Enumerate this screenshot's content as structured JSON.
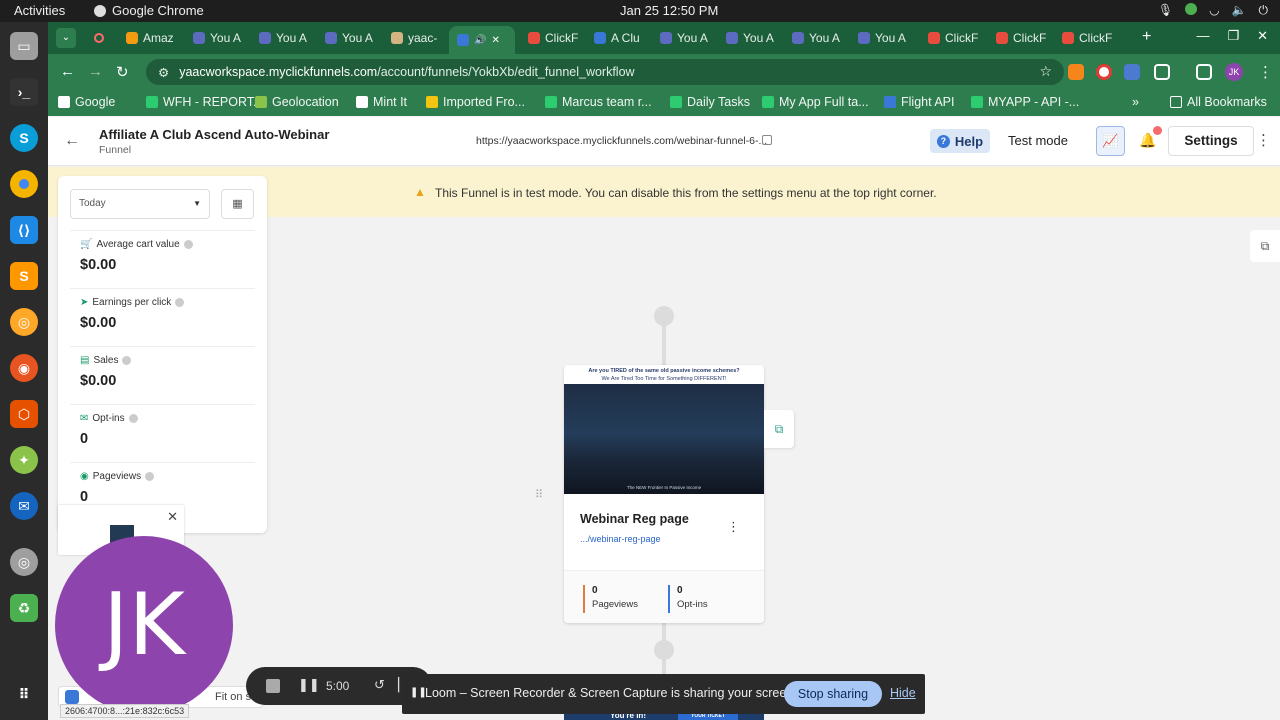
{
  "system": {
    "activities": "Activities",
    "app_name": "Google Chrome",
    "clock": "Jan 25  12:50 PM"
  },
  "browser": {
    "tabs": [
      {
        "label": "Amaz",
        "color": "#f39c12"
      },
      {
        "label": "You A",
        "color": "#5c6bc0"
      },
      {
        "label": "You A",
        "color": "#5c6bc0"
      },
      {
        "label": "You A",
        "color": "#5c6bc0"
      },
      {
        "label": "yaac-",
        "color": "#d4b483"
      },
      {
        "label": "",
        "color": "#3a78d8"
      },
      {
        "label": "ClickF",
        "color": "#e74c3c"
      },
      {
        "label": "A Clu",
        "color": "#3a78d8"
      },
      {
        "label": "You A",
        "color": "#5c6bc0"
      },
      {
        "label": "You A",
        "color": "#5c6bc0"
      },
      {
        "label": "You A",
        "color": "#5c6bc0"
      },
      {
        "label": "You A",
        "color": "#5c6bc0"
      },
      {
        "label": "ClickF",
        "color": "#e74c3c"
      },
      {
        "label": "ClickF",
        "color": "#e74c3c"
      },
      {
        "label": "ClickF",
        "color": "#e74c3c"
      }
    ],
    "url_host": "yaacworkspace.myclickfunnels.com",
    "url_path": "/account/funnels/YokbXb/edit_funnel_workflow",
    "profile_initials": "JK",
    "bookmarks": [
      {
        "label": "Google",
        "color": "#ffffff"
      },
      {
        "label": "WFH - REPORT...",
        "color": "#2ecc71"
      },
      {
        "label": "Geolocation",
        "color": "#8bc34a"
      },
      {
        "label": "Mint It",
        "color": "#ffffff"
      },
      {
        "label": "Imported Fro...",
        "color": "#f1c40f"
      },
      {
        "label": "Marcus team r...",
        "color": "#2ecc71"
      },
      {
        "label": "Daily Tasks",
        "color": "#2ecc71"
      },
      {
        "label": "My App Full ta...",
        "color": "#2ecc71"
      },
      {
        "label": "Flight API",
        "color": "#3a78d8"
      },
      {
        "label": "MYAPP - API -...",
        "color": "#2ecc71"
      }
    ],
    "all_bookmarks": "All Bookmarks"
  },
  "header": {
    "title": "Affiliate A Club Ascend Auto-Webinar",
    "subtitle": "Funnel",
    "url": "https://yaacworkspace.myclickfunnels.com/webinar-funnel-6-...",
    "help": "Help",
    "test_mode": "Test mode",
    "settings": "Settings"
  },
  "banner": {
    "message": "This Funnel is in test mode. You can disable this from the settings menu at the top right corner."
  },
  "metrics": {
    "range": "Today",
    "items": [
      {
        "label": "Average cart value",
        "value": "$0.00"
      },
      {
        "label": "Earnings per click",
        "value": "$0.00"
      },
      {
        "label": "Sales",
        "value": "$0.00"
      },
      {
        "label": "Opt-ins",
        "value": "0"
      },
      {
        "label": "Pageviews",
        "value": "0"
      }
    ]
  },
  "step": {
    "preview_headline": "Are you TIRED of the same old passive income schemes?",
    "preview_sub": "We Are Tired Too Time for Something DIFFERENT!",
    "preview_caption": "The NEW Frontier In Passive Income",
    "title": "Webinar Reg page",
    "path": ".../webinar-reg-page",
    "stats": [
      {
        "value": "0",
        "label": "Pageviews",
        "color": "#e07b39"
      },
      {
        "value": "0",
        "label": "Opt-ins",
        "color": "#3a78d8"
      }
    ],
    "next_peek_title": "You're in!",
    "next_peek_button": "YOUR TICKET"
  },
  "avatar": {
    "initials": "JK"
  },
  "recorder": {
    "time": "5:00"
  },
  "zoom": {
    "fit_label": "Fit on s"
  },
  "status_tip": "2606:4700:8...:21e:832c:6c53",
  "share_bar": {
    "message": "Loom – Screen Recorder & Screen Capture is sharing your screen.",
    "stop": "Stop sharing",
    "hide": "Hide"
  }
}
